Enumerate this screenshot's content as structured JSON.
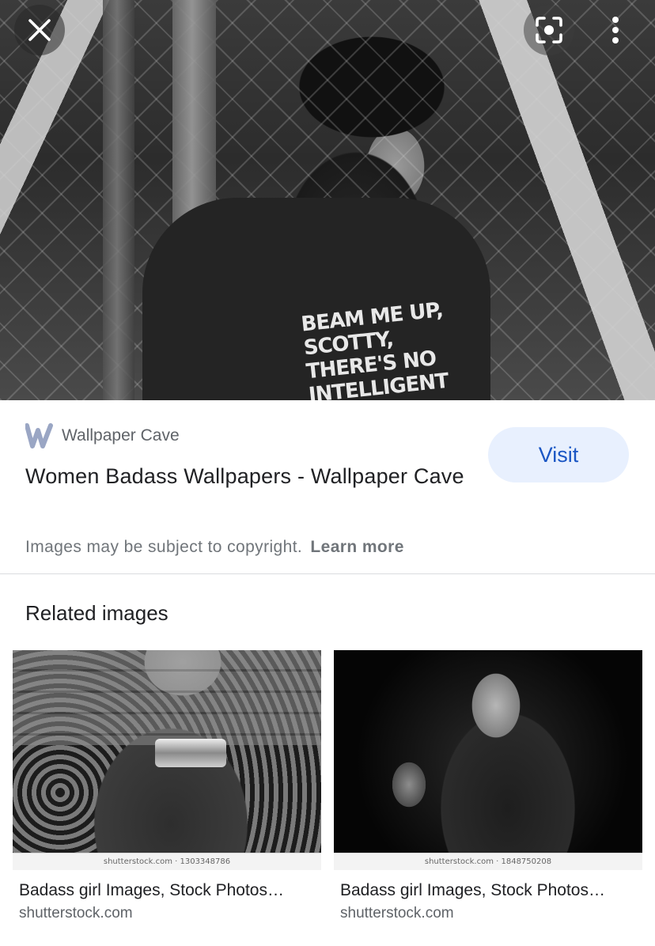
{
  "hero": {
    "shirt_text": "BEAM ME UP, SCOTTY, THERE'S NO INTELLIGENT"
  },
  "toolbar": {
    "close_icon": "close-icon",
    "lens_icon": "google-lens-icon",
    "more_icon": "more-vertical-icon"
  },
  "result": {
    "source_name": "Wallpaper Cave",
    "source_logo": "wallpaper-cave-logo",
    "title": "Women Badass Wallpapers - Wallpaper Cave",
    "visit_label": "Visit",
    "copyright_text": "Images may be subject to copyright.",
    "learn_more": "Learn more"
  },
  "related": {
    "heading": "Related images",
    "items": [
      {
        "watermark": "shutterstock.com · 1303348786",
        "title": "Badass girl Images, Stock Photos…",
        "source": "shutterstock.com"
      },
      {
        "watermark": "shutterstock.com · 1848750208",
        "title": "Badass girl Images, Stock Photos…",
        "source": "shutterstock.com"
      }
    ]
  },
  "colors": {
    "visit_bg": "#e8f0fe",
    "visit_text": "#1a56c4",
    "secondary_text": "#5f6368"
  }
}
